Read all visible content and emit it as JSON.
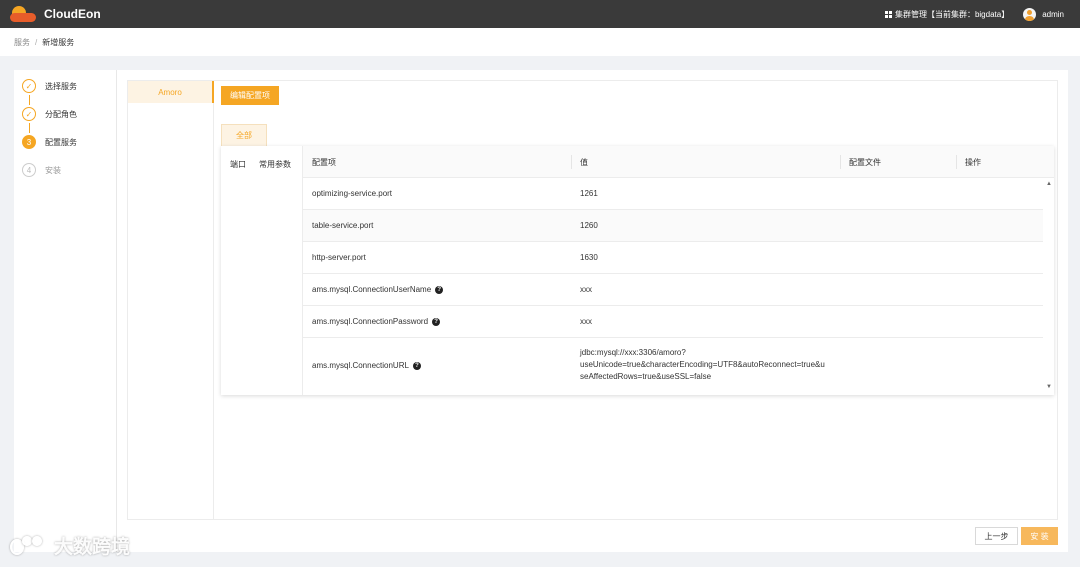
{
  "app": {
    "name": "CloudEon"
  },
  "header": {
    "cluster_label": "集群管理【当前集群：bigdata】",
    "user": "admin"
  },
  "breadcrumb": {
    "parent": "服务",
    "separator": "/",
    "current": "新增服务"
  },
  "steps": [
    {
      "label": "选择服务",
      "state": "done",
      "marker": "✓"
    },
    {
      "label": "分配角色",
      "state": "done",
      "marker": "✓"
    },
    {
      "label": "配置服务",
      "state": "active",
      "marker": "3"
    },
    {
      "label": "安装",
      "state": "pending",
      "marker": "4"
    }
  ],
  "services": [
    {
      "name": "Amoro"
    }
  ],
  "toolbar": {
    "edit_label": "编辑配置项"
  },
  "tabs": [
    {
      "label": "全部"
    }
  ],
  "categories": [
    "端口",
    "常用参数"
  ],
  "table": {
    "headers": [
      "配置项",
      "值",
      "配置文件",
      "操作"
    ],
    "rows": [
      {
        "key": "optimizing-service.port",
        "value": "1261",
        "help": false
      },
      {
        "key": "table-service.port",
        "value": "1260",
        "help": false
      },
      {
        "key": "http-server.port",
        "value": "1630",
        "help": false
      },
      {
        "key": "ams.mysql.ConnectionUserName",
        "value": "xxx",
        "help": true
      },
      {
        "key": "ams.mysql.ConnectionPassword",
        "value": "xxx",
        "help": true
      },
      {
        "key": "ams.mysql.ConnectionURL",
        "value_lines": [
          "jdbc:mysql://xxx:3306/amoro?",
          "useUnicode=true&characterEncoding=UTF8&autoReconnect=true&u",
          "seAffectedRows=true&useSSL=false"
        ],
        "help": true
      }
    ]
  },
  "footer": {
    "prev_label": "上一步",
    "install_label": "安 装"
  },
  "watermark": {
    "text": "大数跨境"
  },
  "colors": {
    "accent": "#f5a623",
    "topbar": "#3a3a3a"
  }
}
